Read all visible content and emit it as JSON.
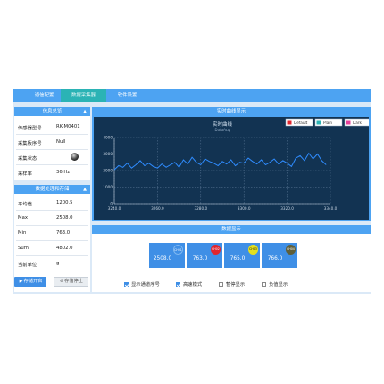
{
  "tabs": [
    {
      "label": "通信配置",
      "active": false
    },
    {
      "label": "数据采集器",
      "active": true
    },
    {
      "label": "软件设置",
      "active": false
    }
  ],
  "info_panel": {
    "title": "信息总览",
    "rows": [
      {
        "label": "传感器型号",
        "value": "RK-M0401"
      },
      {
        "label": "采集板序号",
        "value": "Null"
      },
      {
        "label": "采集状态",
        "value": ""
      },
      {
        "label": "采样率",
        "value": "36 Hz"
      }
    ]
  },
  "data_panel": {
    "title": "数据处理和存储",
    "rows": [
      {
        "label": "平均值",
        "value": "1200.5"
      },
      {
        "label": "Max",
        "value": "2508.0"
      },
      {
        "label": "Min",
        "value": "763.0"
      },
      {
        "label": "Sum",
        "value": "4802.0"
      },
      {
        "label": "当前单位",
        "value": "g"
      }
    ],
    "start_label": "存储开启",
    "stop_label": "存储停止"
  },
  "chart_panel": {
    "header": "实时曲线显示",
    "themes": [
      "Default",
      "Plain",
      "Dark"
    ]
  },
  "chart_data": {
    "type": "line",
    "title": "实时曲线",
    "subtitle": "DataAcq",
    "xlim": [
      3240,
      3340
    ],
    "ylim": [
      0,
      4000
    ],
    "xticks": [
      "3240.0",
      "3260.0",
      "3280.0",
      "3300.0",
      "3320.0",
      "3340.0"
    ],
    "yticks": [
      "0",
      "1000",
      "2000",
      "3000",
      "4000"
    ],
    "grid": true,
    "series": [
      {
        "color": "#2f8cff",
        "x": [
          3240,
          3242,
          3244,
          3246,
          3248,
          3250,
          3252,
          3254,
          3256,
          3258,
          3260,
          3262,
          3264,
          3266,
          3268,
          3270,
          3272,
          3274,
          3276,
          3278,
          3280,
          3282,
          3284,
          3286,
          3288,
          3290,
          3292,
          3294,
          3296,
          3298,
          3300,
          3302,
          3304,
          3306,
          3308,
          3310,
          3312,
          3314,
          3316,
          3318,
          3320,
          3322,
          3324,
          3326,
          3328,
          3330,
          3332,
          3334,
          3336,
          3338
        ],
        "values": [
          2050,
          2300,
          2200,
          2450,
          2150,
          2350,
          2600,
          2300,
          2450,
          2250,
          2150,
          2400,
          2200,
          2350,
          2500,
          2200,
          2650,
          2400,
          2800,
          2500,
          2350,
          2700,
          2550,
          2450,
          2300,
          2550,
          2400,
          2650,
          2300,
          2500,
          2450,
          2750,
          2550,
          2400,
          2650,
          2350,
          2500,
          2700,
          2400,
          2600,
          2450,
          2250,
          2750,
          2900,
          2600,
          3050,
          2700,
          3000,
          2600,
          2350
        ]
      }
    ]
  },
  "stats_panel": {
    "title": "数据显示",
    "cards": [
      {
        "channel": "CH01",
        "value": "2508.0",
        "color": "#3f8fe6"
      },
      {
        "channel": "CH02",
        "value": "763.0",
        "color": "#e0262e"
      },
      {
        "channel": "CH03",
        "value": "765.0",
        "color": "#e4e01e"
      },
      {
        "channel": "CH04",
        "value": "766.0",
        "color": "#5f5f3a"
      }
    ],
    "options": [
      {
        "label": "显示通道序号",
        "checked": true
      },
      {
        "label": "高速模式",
        "checked": true
      },
      {
        "label": "暂停显示",
        "checked": false
      },
      {
        "label": "负值显示",
        "checked": false
      }
    ]
  }
}
